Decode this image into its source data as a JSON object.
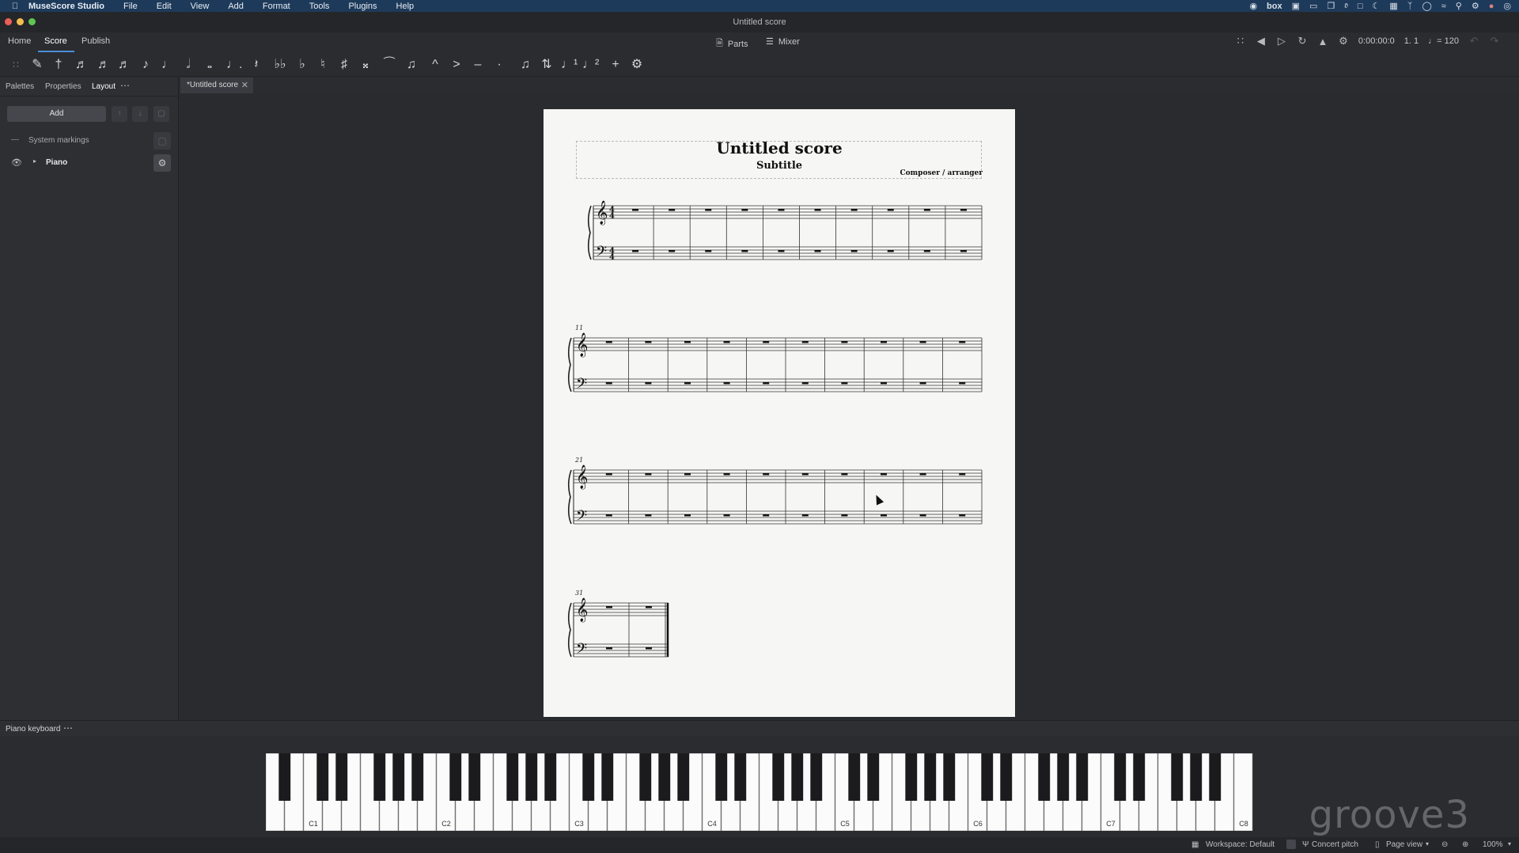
{
  "menubar": {
    "app_name": "MuseScore Studio",
    "items": [
      "File",
      "Edit",
      "View",
      "Add",
      "Format",
      "Tools",
      "Plugins",
      "Help"
    ],
    "tray_box": "box"
  },
  "window": {
    "title": "Untitled score"
  },
  "top_tabs": [
    "Home",
    "Score",
    "Publish"
  ],
  "center_tools": {
    "parts": "Parts",
    "mixer": "Mixer"
  },
  "playback": {
    "time": "0:00:00:0",
    "position": "1. 1",
    "tempo": "♩= 120"
  },
  "note_toolbar": {
    "items": [
      {
        "name": "drag-handle-icon",
        "glyph": "∷"
      },
      {
        "name": "note-input-pen-icon",
        "glyph": "✎"
      },
      {
        "name": "accent-pin-icon",
        "glyph": "†"
      },
      {
        "name": "64th-note-icon",
        "glyph": "♬"
      },
      {
        "name": "32nd-note-icon",
        "glyph": "♬"
      },
      {
        "name": "16th-note-icon",
        "glyph": "♬"
      },
      {
        "name": "eighth-note-icon",
        "glyph": "♪"
      },
      {
        "name": "quarter-note-icon",
        "glyph": "♩"
      },
      {
        "name": "half-note-icon",
        "glyph": "𝅗𝅥"
      },
      {
        "name": "whole-note-icon",
        "glyph": "𝅝"
      },
      {
        "name": "dotted-note-icon",
        "glyph": "♩."
      },
      {
        "name": "rest-icon",
        "glyph": "𝄽"
      },
      {
        "name": "double-flat-icon",
        "glyph": "♭♭"
      },
      {
        "name": "flat-icon",
        "glyph": "♭"
      },
      {
        "name": "natural-icon",
        "glyph": "♮"
      },
      {
        "name": "sharp-icon",
        "glyph": "♯"
      },
      {
        "name": "double-sharp-icon",
        "glyph": "𝄪"
      },
      {
        "name": "tie-icon",
        "glyph": "⁀"
      },
      {
        "name": "beam-icon",
        "glyph": "♫"
      },
      {
        "name": "marcato-icon",
        "glyph": "^"
      },
      {
        "name": "accent-icon",
        "glyph": ">"
      },
      {
        "name": "tenuto-icon",
        "glyph": "–"
      },
      {
        "name": "staccato-icon",
        "glyph": "·"
      },
      {
        "name": "tuplet-icon",
        "glyph": "♫"
      },
      {
        "name": "flip-direction-icon",
        "glyph": "⇅"
      },
      {
        "name": "voice-1-icon",
        "glyph": "♩¹"
      },
      {
        "name": "voice-2-icon",
        "glyph": "♩²"
      },
      {
        "name": "add-icon",
        "glyph": "+"
      },
      {
        "name": "toolbar-settings-icon",
        "glyph": "⚙"
      }
    ]
  },
  "left_panel": {
    "tabs": [
      "Palettes",
      "Properties",
      "Layout"
    ],
    "add_label": "Add",
    "system_markings": "System markings",
    "instrument": "Piano"
  },
  "document_tab": {
    "label": "*Untitled score"
  },
  "score": {
    "title": "Untitled score",
    "subtitle": "Subtitle",
    "composer": "Composer / arranger",
    "time_signature": "4/4",
    "system_starts": [
      "11",
      "21",
      "31"
    ]
  },
  "piano_keyboard": {
    "header": "Piano keyboard",
    "octave_labels": [
      "C1",
      "C2",
      "C3",
      "C4",
      "C5",
      "C6",
      "C7",
      "C8"
    ],
    "watermark": "groove3"
  },
  "status_bar": {
    "workspace": "Workspace: Default",
    "concert_pitch": "Concert pitch",
    "view_mode": "Page view",
    "zoom": "100%"
  }
}
